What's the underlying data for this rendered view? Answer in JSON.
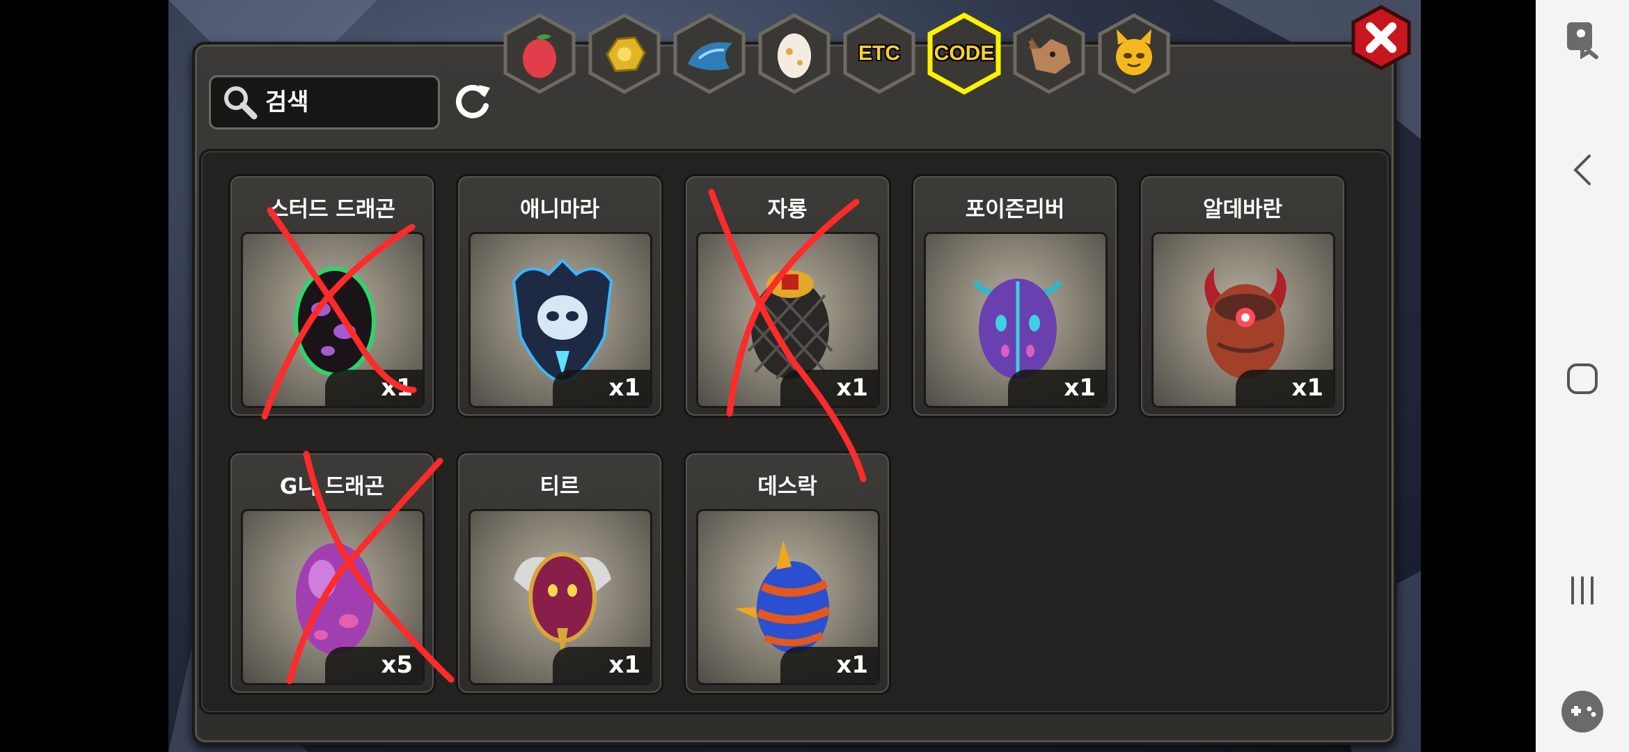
{
  "tabs": [
    {
      "id": "fruit",
      "icon": "fruit-icon",
      "label": ""
    },
    {
      "id": "gold",
      "icon": "gold-nugget-icon",
      "label": ""
    },
    {
      "id": "scale",
      "icon": "dragon-scale-icon",
      "label": ""
    },
    {
      "id": "egg",
      "icon": "egg-icon",
      "label": ""
    },
    {
      "id": "etc",
      "icon": "",
      "label": "ETC"
    },
    {
      "id": "code",
      "icon": "",
      "label": "CODE",
      "selected": true
    },
    {
      "id": "wolf",
      "icon": "wolf-head-icon",
      "label": ""
    },
    {
      "id": "pet",
      "icon": "cat-face-icon",
      "label": ""
    }
  ],
  "search": {
    "placeholder": "검색",
    "value": ""
  },
  "items": [
    {
      "name": "스터드 드래곤",
      "qty": "x1",
      "icon": "black-purple-egg-icon",
      "crossed": true
    },
    {
      "name": "애니마라",
      "qty": "x1",
      "icon": "crystal-skull-egg-icon",
      "crossed": false
    },
    {
      "name": "자룡",
      "qty": "x1",
      "icon": "netted-gold-egg-icon",
      "crossed": true
    },
    {
      "name": "포이즌리버",
      "qty": "x1",
      "icon": "purple-spotted-egg-icon",
      "crossed": false
    },
    {
      "name": "알데바란",
      "qty": "x1",
      "icon": "horned-red-egg-icon",
      "crossed": false
    },
    {
      "name": "G니 드래곤",
      "qty": "x5",
      "icon": "pink-purple-egg-icon",
      "crossed": true
    },
    {
      "name": "티르",
      "qty": "x1",
      "icon": "winged-crimson-egg-icon",
      "crossed": false
    },
    {
      "name": "데스락",
      "qty": "x1",
      "icon": "blue-striped-egg-icon",
      "crossed": false
    }
  ],
  "colors": {
    "accent_gold": "#ffd02a",
    "scribble_red": "#ff2b2b",
    "selected_ring": "#fff200"
  }
}
